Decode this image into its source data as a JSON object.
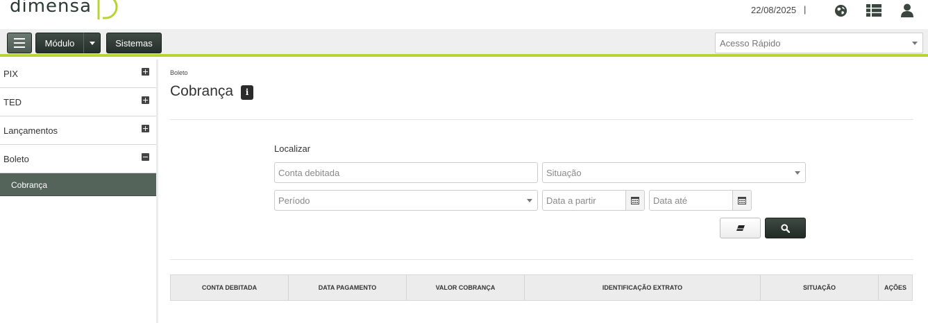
{
  "brand": {
    "name": "Dimensa",
    "accent_color": "#b5d334"
  },
  "header": {
    "date": "22/08/2025",
    "separator": "|",
    "icons": [
      "globe-icon",
      "list-icon",
      "user-icon"
    ]
  },
  "toolbar": {
    "menu_icon": "hamburger-icon",
    "modulo_label": "Módulo",
    "sistemas_label": "Sistemas",
    "quick_access_placeholder": "Acesso Rápido"
  },
  "sidebar": {
    "items": [
      {
        "label": "PIX",
        "state": "collapsed"
      },
      {
        "label": "TED",
        "state": "collapsed"
      },
      {
        "label": "Lançamentos",
        "state": "collapsed"
      },
      {
        "label": "Boleto",
        "state": "expanded"
      }
    ],
    "active_subitem": "Cobrança"
  },
  "main": {
    "breadcrumb": "Boleto",
    "title": "Cobrança",
    "info_icon_glyph": "i",
    "search": {
      "label": "Localizar",
      "conta_placeholder": "Conta debitada",
      "situacao_placeholder": "Situação",
      "periodo_placeholder": "Período",
      "data_partir_placeholder": "Data a partir",
      "data_ate_placeholder": "Data até"
    },
    "table": {
      "columns": [
        "CONTA DEBITADA",
        "DATA PAGAMENTO",
        "VALOR COBRANÇA",
        "IDENTIFICAÇÃO EXTRATO",
        "SITUAÇÃO",
        "AÇÕES"
      ]
    }
  }
}
